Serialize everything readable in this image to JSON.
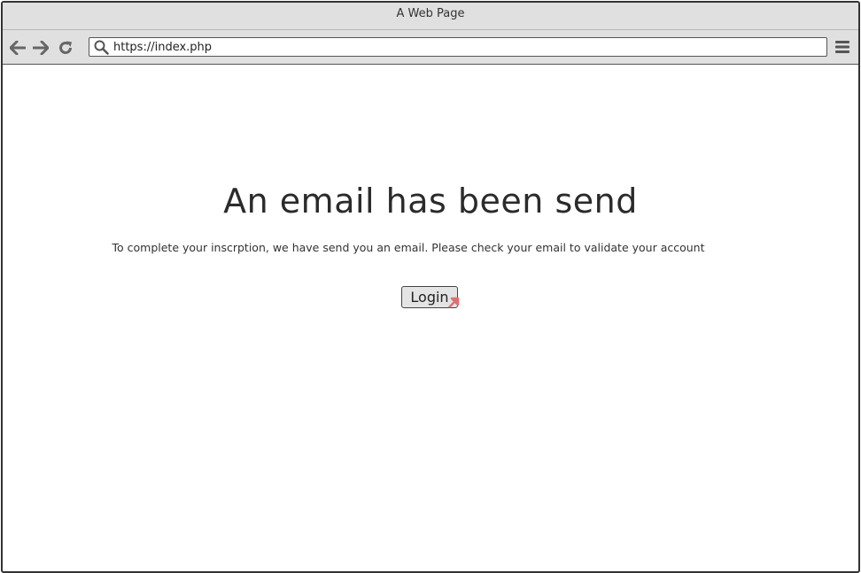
{
  "window": {
    "title": "A Web Page"
  },
  "toolbar": {
    "back_icon": "arrow-left-icon",
    "forward_icon": "arrow-right-icon",
    "reload_icon": "reload-icon",
    "search_icon": "search-icon",
    "url": "https://index.php",
    "menu_icon": "hamburger-menu-icon"
  },
  "page": {
    "heading": "An email has been send",
    "message": "To complete your inscrption, we have send you an email. Please check your email to validate your account",
    "login_label": "Login",
    "link_icon": "link-arrow-icon"
  },
  "colors": {
    "chrome": "#e0e0e0",
    "border": "#333333",
    "link_marker": "#e07070"
  }
}
